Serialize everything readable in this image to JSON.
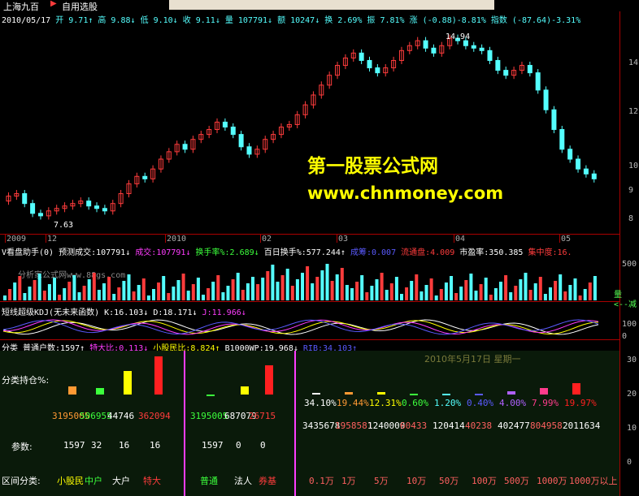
{
  "title_bar": {
    "stock": "上海九百",
    "menu": "自用选股"
  },
  "header": {
    "date": "2010/05/17",
    "open": "开 9.71↑",
    "high": "高 9.88↓",
    "low": "低 9.10↓",
    "close": "收 9.11↓",
    "vol": "量 107791↓",
    "amount": "额 10247↓",
    "turnover": "换 2.69%",
    "amplitude": "振 7.81%",
    "change": "涨 (-0.88)-8.81%",
    "index": "指数 (-87.64)-3.31%"
  },
  "price_labels": {
    "max": "14.94",
    "min": "7.63"
  },
  "watermark": {
    "line1": "第一股票公式网",
    "line2": "www.chnmoney.com",
    "small": "分析家公式网www.88gs.com"
  },
  "price_axis": [
    "14",
    "12",
    "10",
    "9",
    "8"
  ],
  "time_axis": [
    "2009",
    "12",
    "2010",
    "02",
    "03",
    "04",
    "05"
  ],
  "vol_header": {
    "name": "V看盘助手(0) 预测成交:107791↓",
    "cj": "成交:107791↓",
    "hsl": "换手率%:2.689↓",
    "bd": "百日换手%:577.244↑",
    "xg": "成筹:0.007",
    "ltp": "流通盘:4.009",
    "syl": "市盈率:350.385",
    "jzd": "集中度:16."
  },
  "vol_axis": [
    "500",
    "量",
    "<--减"
  ],
  "kdj_header": {
    "name": "短线超级KDJ(无未来函数)",
    "k": "K:16.103↓",
    "d": "D:18.171↓",
    "j": "J:11.966↓"
  },
  "kdj_axis": [
    "100",
    "0"
  ],
  "cls_header": {
    "name": "分类",
    "ptj": "普通户数:1597↑",
    "tdb": "特大比:0.113↓",
    "xgm": "小股民比:8.824↑",
    "b1000": "B1000WP:19.968↓",
    "rank": "RIB:34.103↑"
  },
  "panel_date": "2010年5月17日 星期一",
  "panel": {
    "label_hold": "分类持仓%:",
    "label_param": "参数:",
    "label_range": "区间分类:"
  },
  "group1": {
    "values": [
      "3195005",
      "506955",
      "44746",
      "362094"
    ],
    "params": [
      "1597",
      "32",
      "16",
      "16"
    ],
    "cats": [
      "小股民",
      "中户",
      "大户",
      "特大"
    ],
    "heights": [
      0.2,
      0.15,
      0.55,
      0.9
    ]
  },
  "group2": {
    "values": [
      "3195005",
      "687079",
      "26715"
    ],
    "params": [
      "1597",
      "0",
      "0"
    ],
    "cats": [
      "普通",
      "法人",
      "券基"
    ],
    "heights": [
      0.0,
      0.2,
      0.7
    ]
  },
  "group3": {
    "pcts": [
      "34.10%",
      "19.44%",
      "12.31%",
      "0.60%",
      "1.20%",
      "0.40%",
      "4.00%",
      "7.99%",
      "19.97%"
    ],
    "vals": [
      "3435678",
      "1958581",
      "1240009",
      "60433",
      "120414",
      "40238",
      "402477",
      "804958",
      "2011634"
    ],
    "cats": [
      "0.1万",
      "1万",
      "5万",
      "10万",
      "50万",
      "100万",
      "500万",
      "1000万",
      "1000万以上"
    ]
  },
  "bottom_axis": [
    "30",
    "20",
    "10",
    "0"
  ],
  "colors": {
    "up": "#ff3c3c",
    "down": "#54ffff",
    "grid": "#aa0000"
  }
}
